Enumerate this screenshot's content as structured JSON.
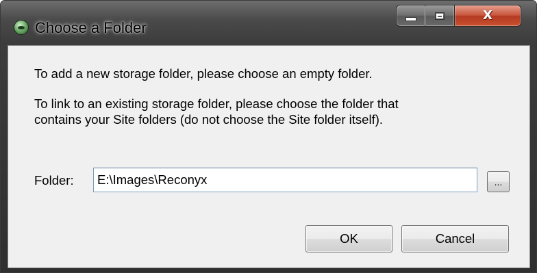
{
  "window": {
    "title": "Choose a Folder",
    "controls": {
      "minimize_icon": "minimize-icon",
      "maximize_icon": "maximize-icon",
      "close_glyph": "X"
    }
  },
  "messages": {
    "line1": "To add a new storage folder, please choose an empty folder.",
    "line2": "To link to an existing storage folder, please choose the folder that",
    "line3": "contains your Site folders (do not choose the Site folder itself)."
  },
  "folder": {
    "label": "Folder:",
    "value": "E:\\Images\\Reconyx",
    "browse_label": "..."
  },
  "buttons": {
    "ok_label": "OK",
    "cancel_label": "Cancel"
  },
  "colors": {
    "titlebar": "#4a4a4a",
    "client_background": "#f0f0f0",
    "close_button": "#c8543b"
  }
}
